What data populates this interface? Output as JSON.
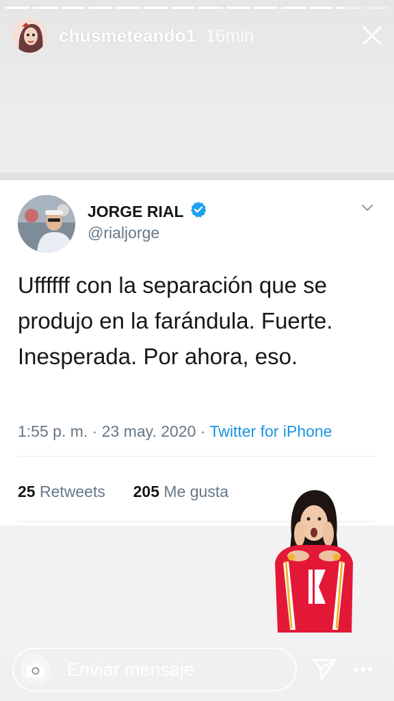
{
  "story": {
    "segments_total": 14,
    "current_segment_index": 12,
    "current_segment_progress": 0.3,
    "username": "chusmeteando1",
    "time": "16min",
    "close_icon": "close-icon"
  },
  "tweet": {
    "display_name": "JORGE RIAL",
    "verified_icon": "verified-badge-icon",
    "handle": "@rialjorge",
    "menu_icon": "chevron-down-icon",
    "text": "Uffffff con la separación que se produjo en la farándula. Fuerte. Inesperada. Por ahora, eso.",
    "time": "1:55 p. m.",
    "date": "23 may. 2020",
    "separator": "·",
    "source": "Twitter for iPhone",
    "retweets_count": "25",
    "retweets_label": "Retweets",
    "likes_count": "205",
    "likes_label": "Me gusta",
    "accent_color": "#1da1f2"
  },
  "sticker": {
    "icon": "surprised-person-sticker-icon"
  },
  "reply_bar": {
    "camera_icon": "camera-icon",
    "placeholder": "Enviar mensaje",
    "send_icon": "send-icon",
    "more_icon": "more-options-icon"
  }
}
